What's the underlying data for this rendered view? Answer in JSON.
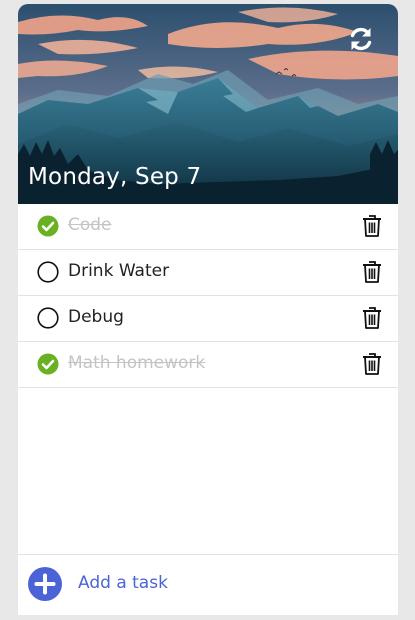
{
  "header": {
    "date": "Monday, Sep 7",
    "refresh_icon": "refresh-icon"
  },
  "tasks": [
    {
      "label": "Code",
      "done": true
    },
    {
      "label": "Drink Water",
      "done": false
    },
    {
      "label": "Debug",
      "done": false
    },
    {
      "label": "Math homework",
      "done": true
    }
  ],
  "footer": {
    "add_label": "Add a task",
    "add_icon": "plus-circle-icon"
  },
  "colors": {
    "check_done": "#6ab023",
    "accent": "#4a64d8",
    "page_background": "#e8e8e8"
  }
}
